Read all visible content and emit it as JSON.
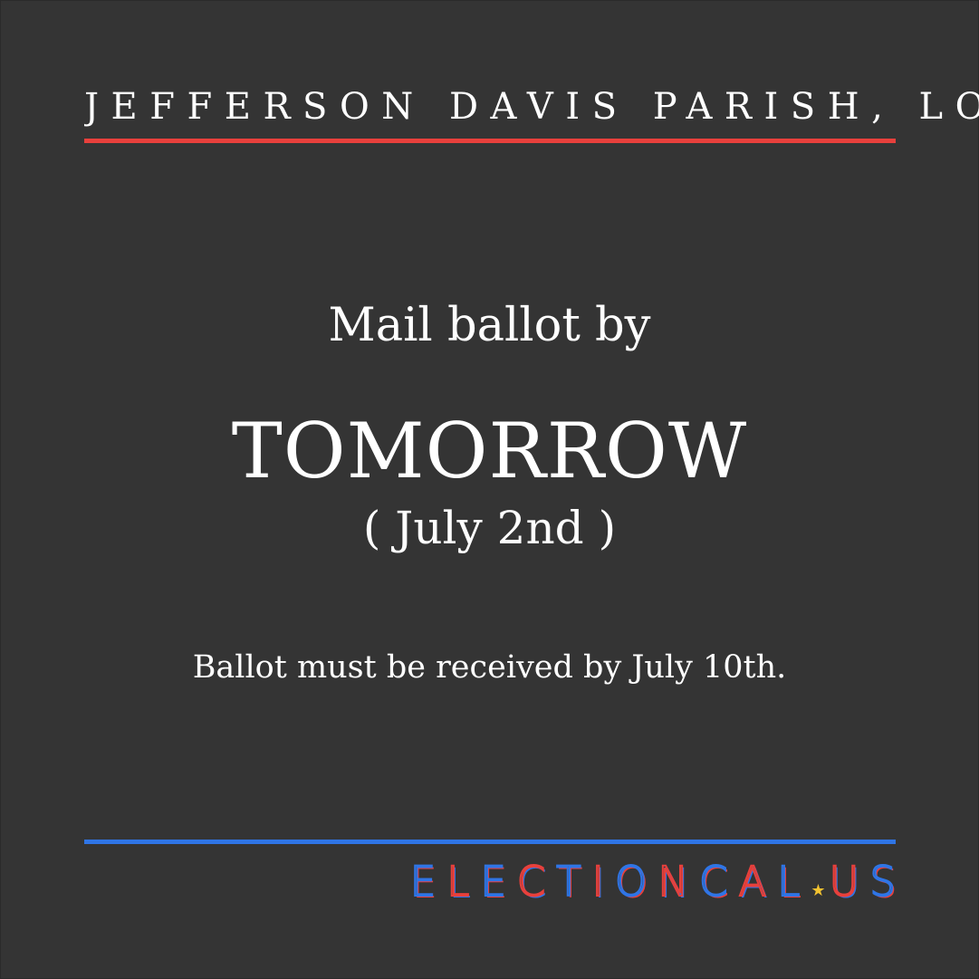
{
  "header": {
    "title": "JEFFERSON DAVIS PARISH, LOUISIANA"
  },
  "main": {
    "lead": "Mail ballot by",
    "deadline": "TOMORROW",
    "date": "( July 2nd )",
    "note": "Ballot must be received by July 10th."
  },
  "brand": {
    "logo_text": "ELECTIONCAL.US",
    "letters": [
      "E",
      "L",
      "E",
      "C",
      "T",
      "I",
      "O",
      "N",
      "C",
      "A",
      "L",
      "U",
      "S"
    ],
    "star_icon": "star-icon",
    "colors": {
      "red": "#e8403c",
      "blue": "#2f75e6",
      "star": "#f2c230",
      "background": "#343434"
    }
  }
}
